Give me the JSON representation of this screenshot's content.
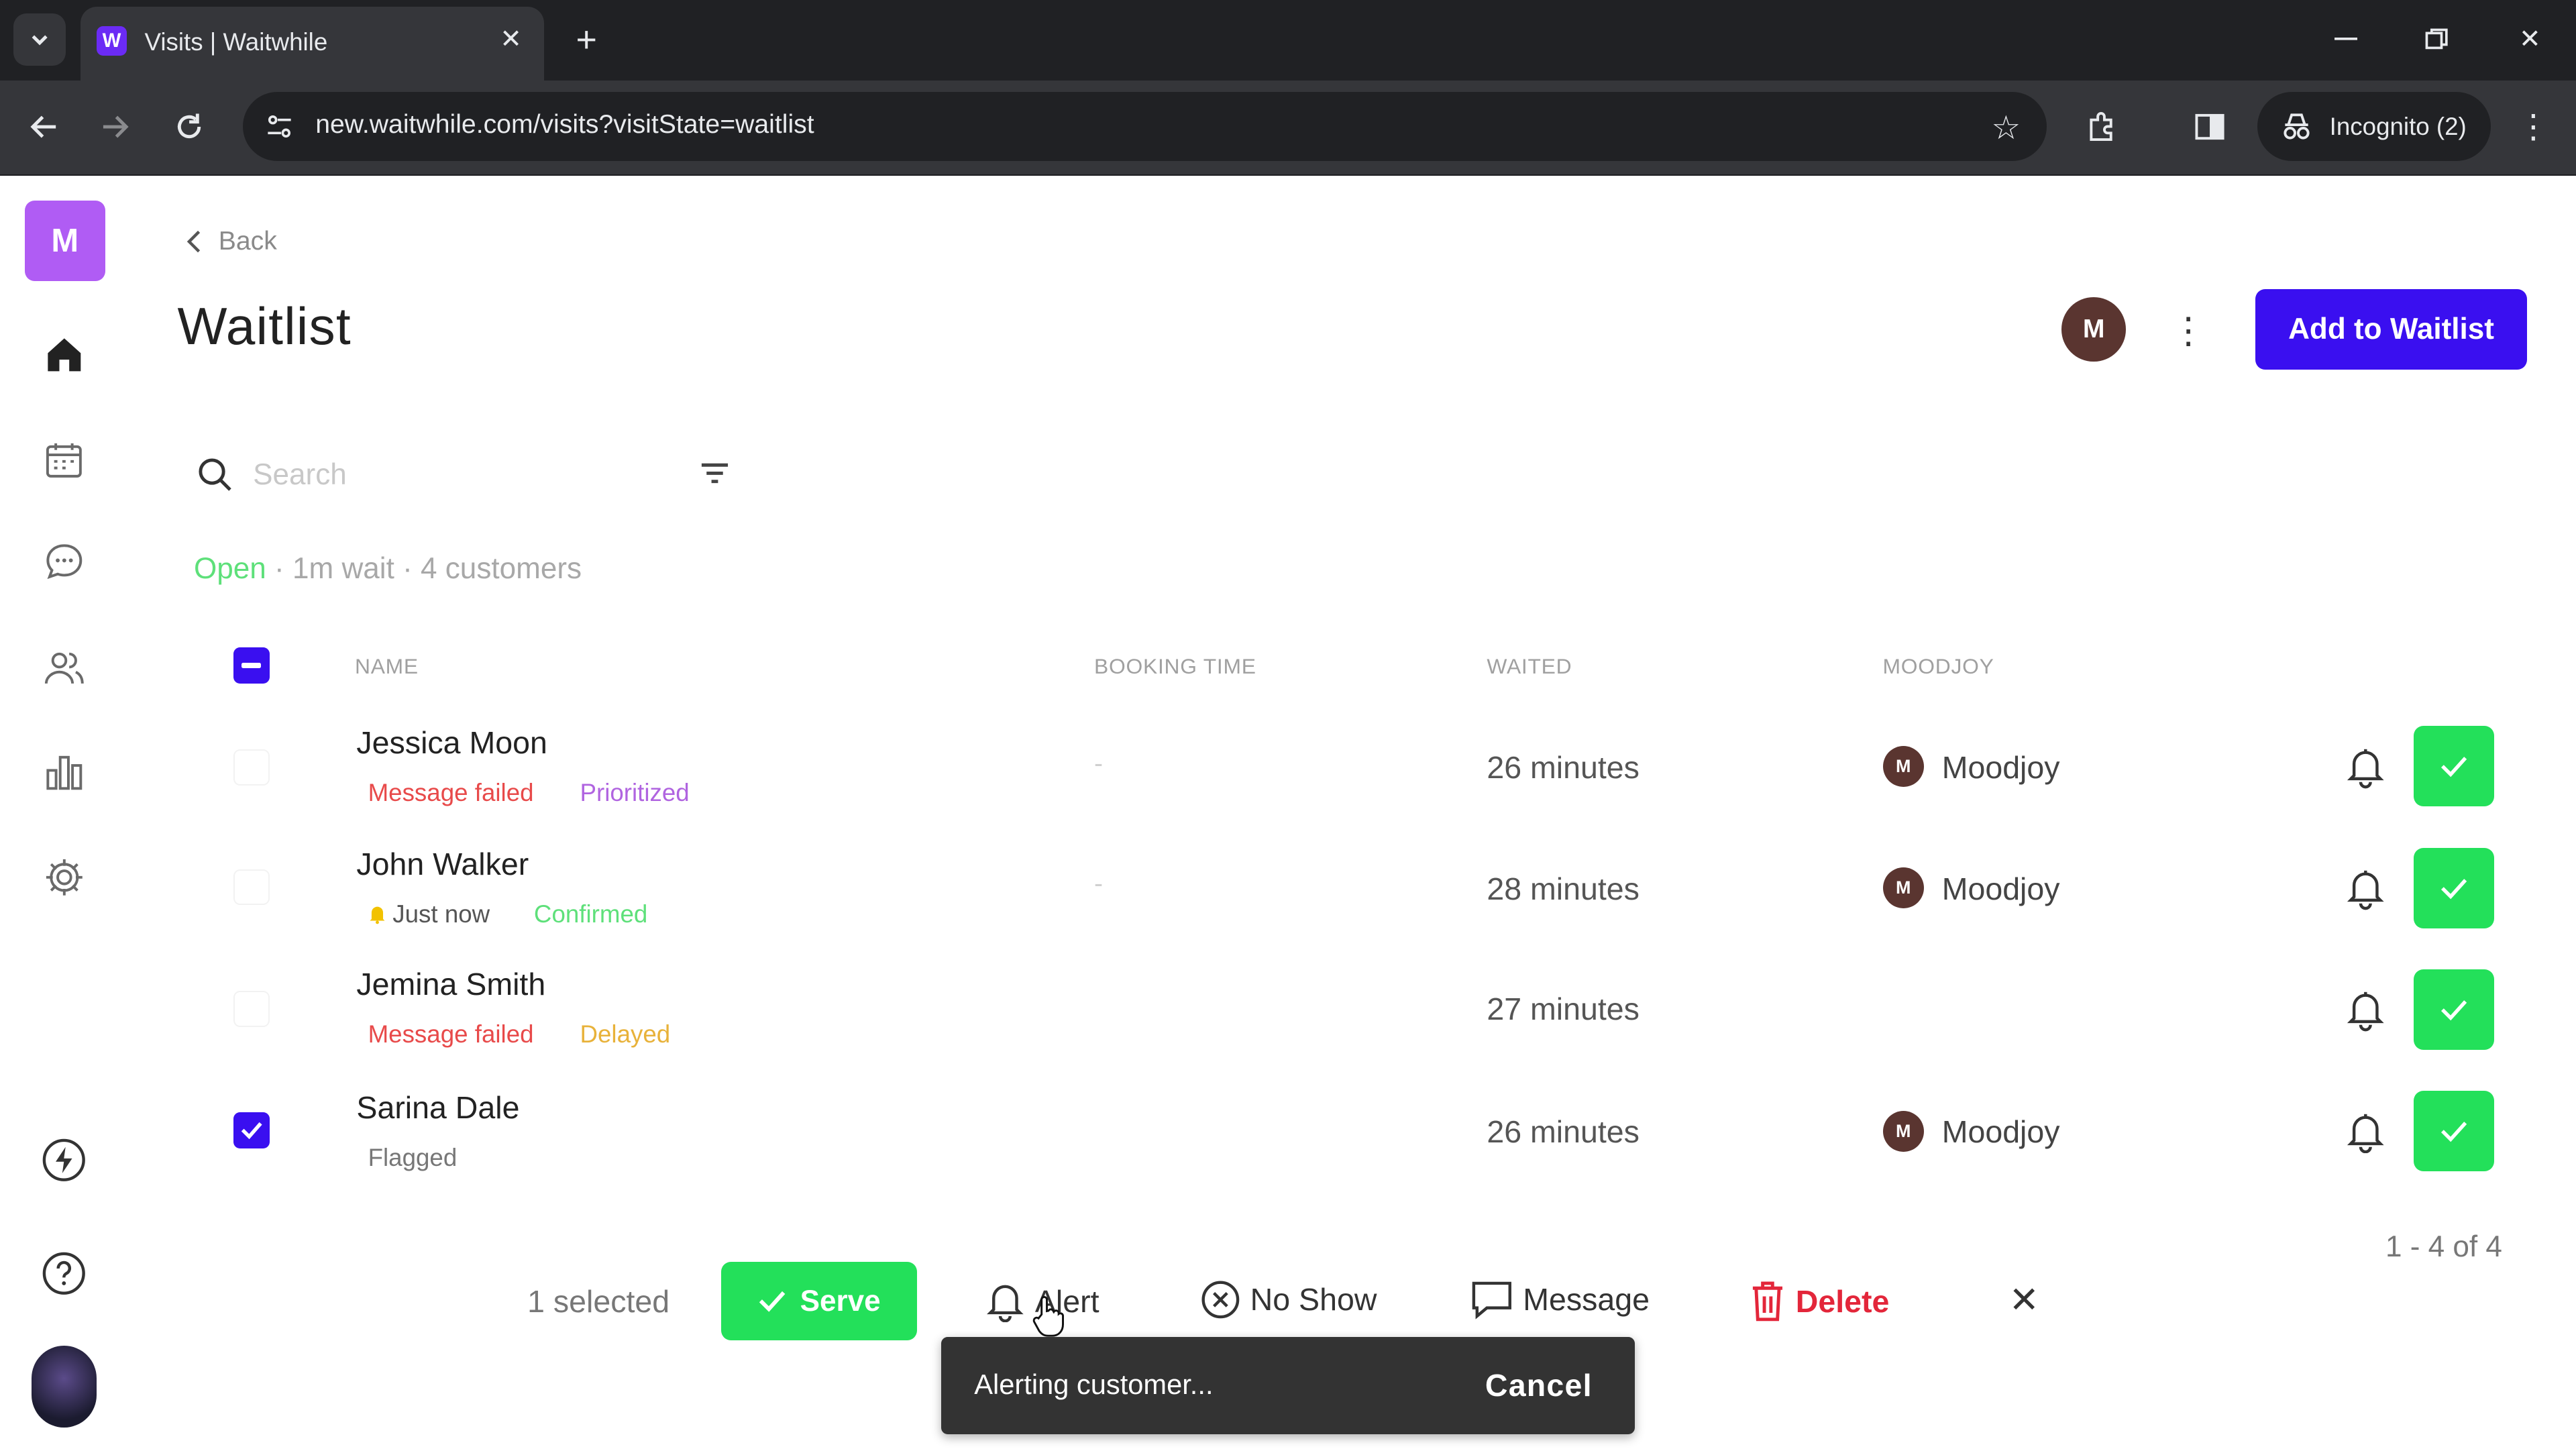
{
  "browser": {
    "tab_title": "Visits | Waitwhile",
    "tab_favicon_letter": "W",
    "url": "new.waitwhile.com/visits?visitState=waitlist",
    "incognito_label": "Incognito (2)"
  },
  "sidebar": {
    "brand_letter": "M",
    "items": [
      {
        "name": "home-icon",
        "active": true
      },
      {
        "name": "calendar-icon"
      },
      {
        "name": "chat-icon"
      },
      {
        "name": "customers-icon"
      },
      {
        "name": "analytics-icon"
      },
      {
        "name": "settings-icon"
      },
      {
        "name": "lightning-icon"
      },
      {
        "name": "help-icon"
      }
    ]
  },
  "header": {
    "back_label": "Back",
    "title": "Waitlist",
    "avatar_letter": "M",
    "add_button": "Add to Waitlist"
  },
  "search": {
    "placeholder": "Search"
  },
  "status": {
    "open": "Open",
    "rest": " · 1m wait · 4 customers"
  },
  "table": {
    "columns": {
      "name": "NAME",
      "booking_time": "BOOKING TIME",
      "waited": "WAITED",
      "location": "MOODJOY"
    },
    "rows": [
      {
        "name": "Jessica Moon",
        "tag1": "Message failed",
        "tag2": "Prioritized",
        "booking": "-",
        "waited": "26 minutes",
        "loc_letter": "M",
        "location": "Moodjoy",
        "checked": false
      },
      {
        "name": "John Walker",
        "tag1": "Just now",
        "tag2": "Confirmed",
        "booking": "-",
        "waited": "28 minutes",
        "loc_letter": "M",
        "location": "Moodjoy",
        "checked": false
      },
      {
        "name": "Jemina Smith",
        "tag1": "Message failed",
        "tag2": "Delayed",
        "waited": "27 minutes",
        "checked": false
      },
      {
        "name": "Sarina Dale",
        "tag1": "Flagged",
        "waited": "26 minutes",
        "loc_letter": "M",
        "location": "Moodjoy",
        "checked": true
      }
    ],
    "pagination": "1 - 4 of 4"
  },
  "bulk": {
    "selected": "1 selected",
    "serve": "Serve",
    "alert": "Alert",
    "no_show": "No Show",
    "message": "Message",
    "delete": "Delete"
  },
  "snackbar": {
    "text": "Alerting customer...",
    "action": "Cancel"
  },
  "colors": {
    "primary": "#3a0ff0",
    "success": "#23e05a",
    "danger": "#e3263a",
    "open": "#5ee07a",
    "brand": "#b05cf4",
    "tag_message_failed": "#e84a4a",
    "tag_prioritized": "#b064e0",
    "tag_confirmed": "#5ee07a",
    "tag_delayed": "#e8b23a"
  }
}
